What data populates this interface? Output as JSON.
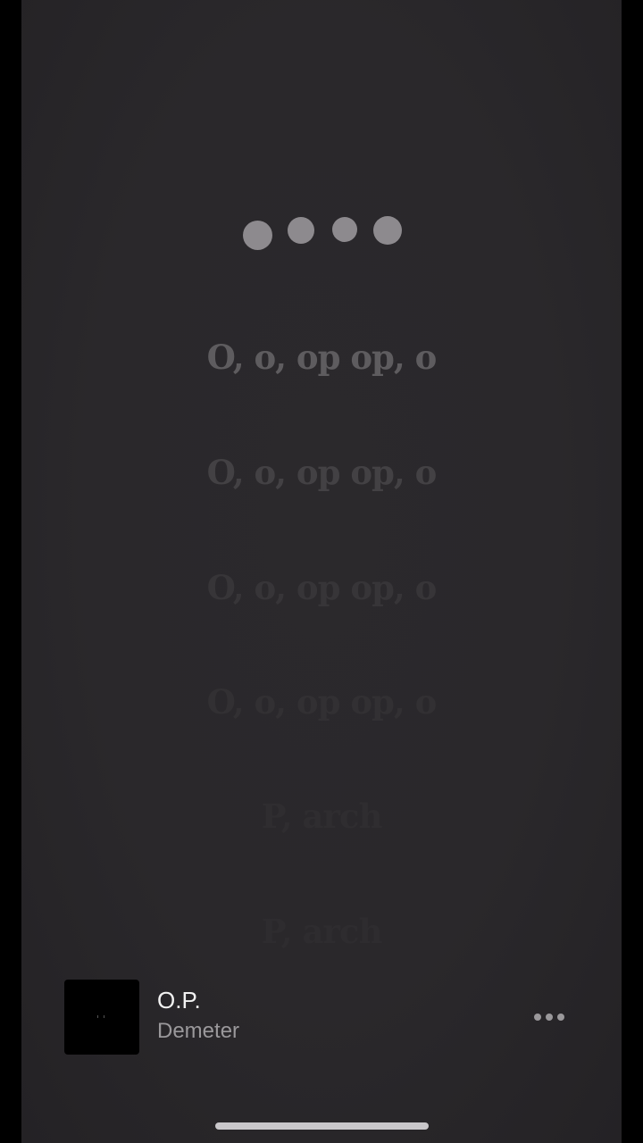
{
  "lyrics": {
    "waiting_indicator_icon": "ellipsis-dots-icon",
    "lines": [
      {
        "text": "O, o, op op, o",
        "color": "#5e5c5f"
      },
      {
        "text": "O, o, op op, o",
        "color": "#434144"
      },
      {
        "text": "O, o, op op, o",
        "color": "#373538"
      },
      {
        "text": "O, o, op op, o",
        "color": "#323033"
      },
      {
        "text": "P, arch",
        "color": "#2f2d30"
      },
      {
        "text": "P, arch",
        "color": "#2e2c2f"
      }
    ]
  },
  "now_playing": {
    "title": "O.P.",
    "artist": "Demeter",
    "more_icon": "more-horizontal-icon"
  },
  "colors": {
    "background": "#2a282b",
    "title": "#f2f2f2",
    "artist": "#9a989b"
  }
}
